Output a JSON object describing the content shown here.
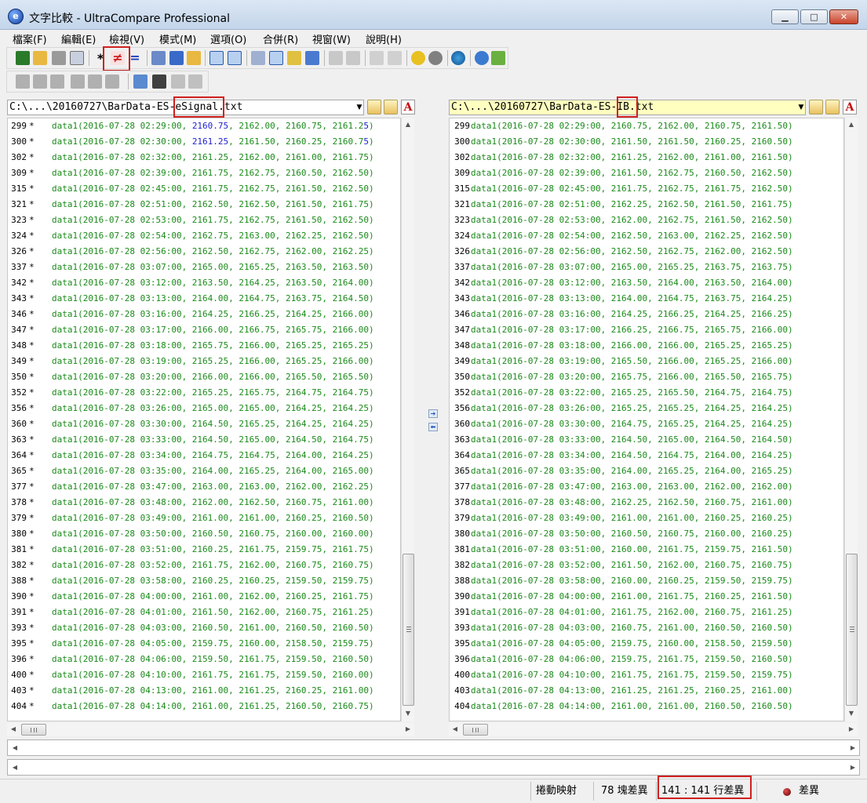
{
  "window": {
    "title": "文字比較 - UltraCompare Professional",
    "app_icon": "ultracompare-logo-icon",
    "app_icon_glyph": "e",
    "minimize": "▁",
    "maximize": "□",
    "close": "✕"
  },
  "menu": [
    "檔案(F)",
    "編輯(E)",
    "檢視(V)",
    "模式(M)",
    "選項(O)",
    "合併(R)",
    "視窗(W)",
    "說明(H)"
  ],
  "toolbar": {
    "row1_icons": [
      "save-icon",
      "open-folder-icon",
      "print-icon",
      "print-preview-icon",
      "show-all-icon",
      "show-differences-icon",
      "show-matches-icon",
      "copy-icon",
      "binary-compare-icon",
      "folder-icon",
      "two-way-vertical-icon",
      "two-way-horizontal-icon",
      "merge-icon",
      "list-view-icon",
      "report-icon",
      "sync-icon",
      "next-difference-icon",
      "previous-difference-icon",
      "copy-left-icon",
      "copy-right-icon",
      "settings-icon",
      "stop-icon",
      "web-icon",
      "info-icon",
      "refresh-icon"
    ],
    "row2_icons": [
      "move-left-icon",
      "move-left-block-icon",
      "move-left-all-icon",
      "move-right-icon",
      "move-right-block-icon",
      "move-right-all-icon",
      "edit-icon",
      "save-file-icon",
      "undo-icon",
      "redo-icon"
    ],
    "glyphs": {
      "show_all": "*",
      "show_differences": "≠",
      "show_matches": "="
    }
  },
  "left": {
    "path": "C:\\...\\20160727\\BarData-ES-eSignal.txt",
    "dropdown": "▼"
  },
  "right": {
    "path": "C:\\...\\20160727\\BarData-ES-IB.txt",
    "dropdown": "▼"
  },
  "lines": {
    "numbers": [
      "299",
      "300",
      "302",
      "309",
      "315",
      "321",
      "323",
      "324",
      "326",
      "337",
      "342",
      "343",
      "346",
      "347",
      "348",
      "349",
      "350",
      "352",
      "356",
      "360",
      "363",
      "364",
      "365",
      "377",
      "378",
      "379",
      "380",
      "381",
      "382",
      "388",
      "390",
      "391",
      "393",
      "395",
      "396",
      "400",
      "403",
      "404"
    ],
    "left_numbers": [
      "299",
      "300",
      "302",
      "309",
      "315",
      "321",
      "323",
      "324",
      "326",
      "337",
      "342",
      "343",
      "346",
      "347",
      "348",
      "349",
      "350",
      "352",
      "356",
      "360",
      "363",
      "364",
      "365",
      "377",
      "378",
      "379",
      "380",
      "381",
      "382",
      "388",
      "390",
      "391",
      "393",
      "395",
      "396",
      "400",
      "403",
      "404"
    ],
    "marker": "*",
    "left": [
      [
        "data1(2016-07-28 02:29:00, ",
        "2160.75",
        ", 2162.00, 2160.75, 2161.2",
        "5",
        ")"
      ],
      [
        "data1(2016-07-28 02:30:00, ",
        "2161.25",
        ", 2161.50, 2160.25, 2160.7",
        "5",
        ")"
      ],
      [
        "data1(2016-07-28 02:32:00, 2161.25, 2162.00, 2161.00, 2161.75)"
      ],
      [
        "data1(2016-07-28 02:39:00, 2161.75, 2162.75, 2160.50, 2162.50)"
      ],
      [
        "data1(2016-07-28 02:45:00, 2161.75, 2162.75, 2161.50, 2162.50)"
      ],
      [
        "data1(2016-07-28 02:51:00, 2162.50, 2162.50, 2161.50, 2161.75)"
      ],
      [
        "data1(2016-07-28 02:53:00, 2161.75, 2162.75, 2161.50, 2162.50)"
      ],
      [
        "data1(2016-07-28 02:54:00, 2162.75, 2163.00, 2162.25, 2162.50)"
      ],
      [
        "data1(2016-07-28 02:56:00, 2162.50, 2162.75, 2162.00, 2162.25)"
      ],
      [
        "data1(2016-07-28 03:07:00, 2165.00, 2165.25, 2163.50, 2163.50)"
      ],
      [
        "data1(2016-07-28 03:12:00, 2163.50, 2164.25, 2163.50, 2164.00)"
      ],
      [
        "data1(2016-07-28 03:13:00, 2164.00, 2164.75, 2163.75, 2164.50)"
      ],
      [
        "data1(2016-07-28 03:16:00, 2164.25, 2166.25, 2164.25, 2166.00)"
      ],
      [
        "data1(2016-07-28 03:17:00, 2166.00, 2166.75, 2165.75, 2166.00)"
      ],
      [
        "data1(2016-07-28 03:18:00, 2165.75, 2166.00, 2165.25, 2165.25)"
      ],
      [
        "data1(2016-07-28 03:19:00, 2165.25, 2166.00, 2165.25, 2166.00)"
      ],
      [
        "data1(2016-07-28 03:20:00, 2166.00, 2166.00, 2165.50, 2165.50)"
      ],
      [
        "data1(2016-07-28 03:22:00, 2165.25, 2165.75, 2164.75, 2164.75)"
      ],
      [
        "data1(2016-07-28 03:26:00, 2165.00, 2165.00, 2164.25, 2164.25)"
      ],
      [
        "data1(2016-07-28 03:30:00, 2164.50, 2165.25, 2164.25, 2164.25)"
      ],
      [
        "data1(2016-07-28 03:33:00, 2164.50, 2165.00, 2164.50, 2164.75)"
      ],
      [
        "data1(2016-07-28 03:34:00, 2164.75, 2164.75, 2164.00, 2164.25)"
      ],
      [
        "data1(2016-07-28 03:35:00, 2164.00, 2165.25, 2164.00, 2165.00)"
      ],
      [
        "data1(2016-07-28 03:47:00, 2163.00, 2163.00, 2162.00, 2162.25)"
      ],
      [
        "data1(2016-07-28 03:48:00, 2162.00, 2162.50, 2160.75, 2161.00)"
      ],
      [
        "data1(2016-07-28 03:49:00, 2161.00, 2161.00, 2160.25, 2160.50)"
      ],
      [
        "data1(2016-07-28 03:50:00, 2160.50, 2160.75, 2160.00, 2160.00)"
      ],
      [
        "data1(2016-07-28 03:51:00, 2160.25, 2161.75, 2159.75, 2161.75)"
      ],
      [
        "data1(2016-07-28 03:52:00, 2161.75, 2162.00, 2160.75, 2160.75)"
      ],
      [
        "data1(2016-07-28 03:58:00, 2160.25, 2160.25, 2159.50, 2159.75)"
      ],
      [
        "data1(2016-07-28 04:00:00, 2161.00, 2162.00, 2160.25, 2161.75)"
      ],
      [
        "data1(2016-07-28 04:01:00, 2161.50, 2162.00, 2160.75, 2161.25)"
      ],
      [
        "data1(2016-07-28 04:03:00, 2160.50, 2161.00, 2160.50, 2160.50)"
      ],
      [
        "data1(2016-07-28 04:05:00, 2159.75, 2160.00, 2158.50, 2159.75)"
      ],
      [
        "data1(2016-07-28 04:06:00, 2159.50, 2161.75, 2159.50, 2160.50)"
      ],
      [
        "data1(2016-07-28 04:10:00, 2161.75, 2161.75, 2159.50, 2160.00)"
      ],
      [
        "data1(2016-07-28 04:13:00, 2161.00, 2161.25, 2160.25, 2161.00)"
      ],
      [
        "data1(2016-07-28 04:14:00, 2161.00, 2161.25, 2160.50, 2160.75)"
      ]
    ],
    "right": [
      [
        "data1(2016-07-28 02:29:00, 2160.75, 2162.00, 2160.75, 2161.50)"
      ],
      [
        "data1(2016-07-28 02:30:00, 2161.50, 2161.50, 2160.25, 2160.50)"
      ],
      [
        "data1(2016-07-28 02:32:00, 2161.25, 2162.00, 2161.00, 2161.50)"
      ],
      [
        "data1(2016-07-28 02:39:00, 2161.50, 2162.75, 2160.50, 2162.50)"
      ],
      [
        "data1(2016-07-28 02:45:00, 2161.75, 2162.75, 2161.75, 2162.50)"
      ],
      [
        "data1(2016-07-28 02:51:00, 2162.25, 2162.50, 2161.50, 2161.75)"
      ],
      [
        "data1(2016-07-28 02:53:00, 2162.00, 2162.75, 2161.50, 2162.50)"
      ],
      [
        "data1(2016-07-28 02:54:00, 2162.50, 2163.00, 2162.25, 2162.50)"
      ],
      [
        "data1(2016-07-28 02:56:00, 2162.50, 2162.75, 2162.00, 2162.50)"
      ],
      [
        "data1(2016-07-28 03:07:00, 2165.00, 2165.25, 2163.75, 2163.75)"
      ],
      [
        "data1(2016-07-28 03:12:00, 2163.50, 2164.00, 2163.50, 2164.00)"
      ],
      [
        "data1(2016-07-28 03:13:00, 2164.00, 2164.75, 2163.75, 2164.25)"
      ],
      [
        "data1(2016-07-28 03:16:00, 2164.25, 2166.25, 2164.25, 2166.25)"
      ],
      [
        "data1(2016-07-28 03:17:00, 2166.25, 2166.75, 2165.75, 2166.00)"
      ],
      [
        "data1(2016-07-28 03:18:00, 2166.00, 2166.00, 2165.25, 2165.25)"
      ],
      [
        "data1(2016-07-28 03:19:00, 2165.50, 2166.00, 2165.25, 2166.00)"
      ],
      [
        "data1(2016-07-28 03:20:00, 2165.75, 2166.00, 2165.50, 2165.75)"
      ],
      [
        "data1(2016-07-28 03:22:00, 2165.25, 2165.50, 2164.75, 2164.75)"
      ],
      [
        "data1(2016-07-28 03:26:00, 2165.25, 2165.25, 2164.25, 2164.25)"
      ],
      [
        "data1(2016-07-28 03:30:00, 2164.75, 2165.25, 2164.25, 2164.25)"
      ],
      [
        "data1(2016-07-28 03:33:00, 2164.50, 2165.00, 2164.50, 2164.50)"
      ],
      [
        "data1(2016-07-28 03:34:00, 2164.50, 2164.75, 2164.00, 2164.25)"
      ],
      [
        "data1(2016-07-28 03:35:00, 2164.00, 2165.25, 2164.00, 2165.25)"
      ],
      [
        "data1(2016-07-28 03:47:00, 2163.00, 2163.00, 2162.00, 2162.00)"
      ],
      [
        "data1(2016-07-28 03:48:00, 2162.25, 2162.50, 2160.75, 2161.00)"
      ],
      [
        "data1(2016-07-28 03:49:00, 2161.00, 2161.00, 2160.25, 2160.25)"
      ],
      [
        "data1(2016-07-28 03:50:00, 2160.50, 2160.75, 2160.00, 2160.25)"
      ],
      [
        "data1(2016-07-28 03:51:00, 2160.00, 2161.75, 2159.75, 2161.50)"
      ],
      [
        "data1(2016-07-28 03:52:00, 2161.50, 2162.00, 2160.75, 2160.75)"
      ],
      [
        "data1(2016-07-28 03:58:00, 2160.00, 2160.25, 2159.50, 2159.75)"
      ],
      [
        "data1(2016-07-28 04:00:00, 2161.00, 2161.75, 2160.25, 2161.50)"
      ],
      [
        "data1(2016-07-28 04:01:00, 2161.75, 2162.00, 2160.75, 2161.25)"
      ],
      [
        "data1(2016-07-28 04:03:00, 2160.75, 2161.00, 2160.50, 2160.50)"
      ],
      [
        "data1(2016-07-28 04:05:00, 2159.75, 2160.00, 2158.50, 2159.50)"
      ],
      [
        "data1(2016-07-28 04:06:00, 2159.75, 2161.75, 2159.50, 2160.50)"
      ],
      [
        "data1(2016-07-28 04:10:00, 2161.75, 2161.75, 2159.50, 2159.75)"
      ],
      [
        "data1(2016-07-28 04:13:00, 2161.25, 2161.25, 2160.25, 2161.00)"
      ],
      [
        "data1(2016-07-28 04:14:00, 2161.00, 2161.00, 2160.50, 2160.50)"
      ]
    ]
  },
  "scroll_arrows": {
    "up": "▲",
    "down": "▼",
    "left": "◀",
    "right": "▶"
  },
  "nav": {
    "next": "➔",
    "prev": "⬅"
  },
  "statusbar": {
    "scroll_mapping": "捲動映射",
    "block_diffs": "78 塊差異",
    "line_diffs": "141 : 141 行差異",
    "diff_label": "差異"
  },
  "colors": {
    "code": "#1a8a1a",
    "diff_highlight": "#2020d0",
    "annotation_box": "#d02020",
    "right_path_bg": "#ffffc0"
  }
}
